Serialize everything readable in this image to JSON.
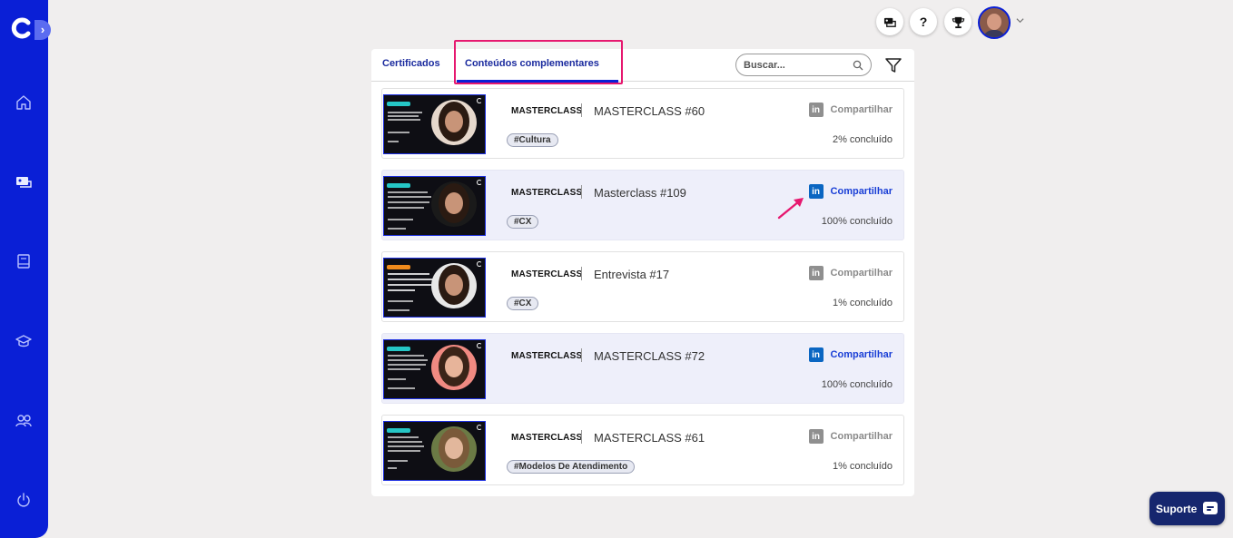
{
  "sidebar": {
    "expand_glyph": "›",
    "icons": [
      "logo-icon",
      "home-icon",
      "courses-icon",
      "book-icon",
      "graduation-cap-icon",
      "users-icon",
      "power-icon"
    ]
  },
  "header": {
    "help_label": "?",
    "icons": [
      "chat-board-icon",
      "help-icon",
      "trophy-icon",
      "user-avatar",
      "chevron-down-icon"
    ]
  },
  "tabs": [
    {
      "label": "Certificados",
      "active": false
    },
    {
      "label": "Conteúdos complementares",
      "active": true
    }
  ],
  "search": {
    "placeholder": "Buscar..."
  },
  "accent_color": "#0a1fd6",
  "highlight_color": "#e6186f",
  "linkedin_color": "#0a66c2",
  "items": [
    {
      "type": "MASTERCLASS",
      "title": "MASTERCLASS #60",
      "tag": "#Cultura",
      "share": "Compartilhar",
      "progress": "2% concluído",
      "highlighted": false
    },
    {
      "type": "MASTERCLASS",
      "title": "Masterclass #109",
      "tag": "#CX",
      "share": "Compartilhar",
      "progress": "100% concluído",
      "highlighted": true
    },
    {
      "type": "MASTERCLASS",
      "title": "Entrevista #17",
      "tag": "#CX",
      "share": "Compartilhar",
      "progress": "1% concluído",
      "highlighted": false
    },
    {
      "type": "MASTERCLASS",
      "title": "MASTERCLASS #72",
      "tag": "",
      "share": "Compartilhar",
      "progress": "100% concluído",
      "highlighted": true
    },
    {
      "type": "MASTERCLASS",
      "title": "MASTERCLASS #61",
      "tag": "#Modelos De Atendimento",
      "share": "Compartilhar",
      "progress": "1% concluído",
      "highlighted": false
    }
  ],
  "support": {
    "label": "Suporte"
  }
}
